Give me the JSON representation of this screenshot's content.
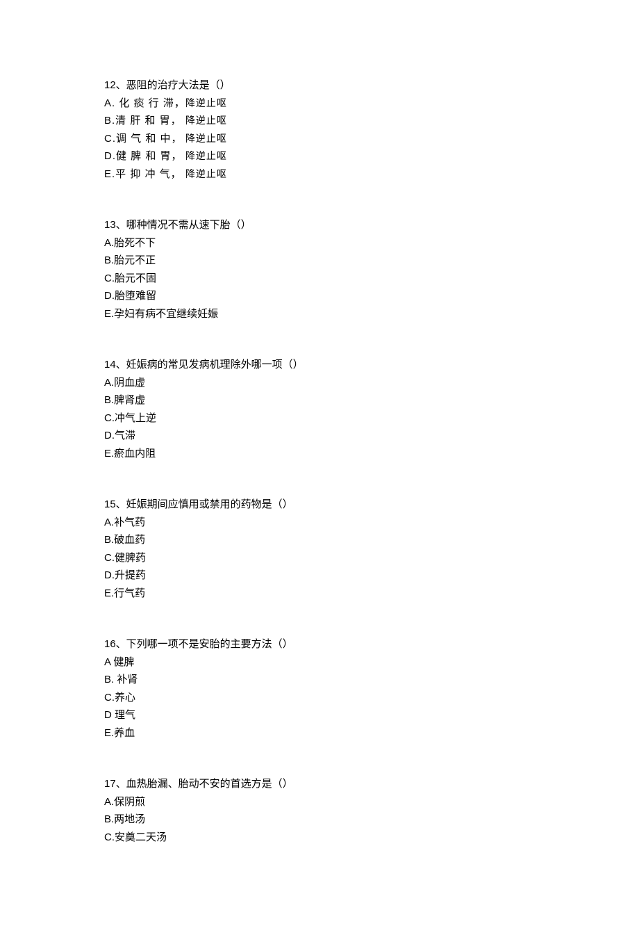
{
  "q12": {
    "stem": "12、恶阻的治疗大法是（）",
    "rows": [
      {
        "left": "A. 化 痰 行 滞，",
        "right": "降逆止呕"
      },
      {
        "left": "B.清 肝 和 胃，",
        "right": "降逆止呕"
      },
      {
        "left": "C.调 气 和 中，",
        "right": "降逆止呕"
      },
      {
        "left": "D.健 脾 和 胃，",
        "right": "降逆止呕"
      },
      {
        "left": "E.平 抑 冲 气，",
        "right": "降逆止呕"
      }
    ]
  },
  "q13": {
    "stem": "13、哪种情况不需从速下胎（）",
    "opts": [
      "A.胎死不下",
      "B.胎元不正",
      "C.胎元不固",
      "D.胎堕难留",
      "E.孕妇有病不宜继续妊娠"
    ]
  },
  "q14": {
    "stem": "14、妊娠病的常见发病机理除外哪一项（）",
    "opts": [
      "A.阴血虚",
      "B.脾肾虚",
      "C.冲气上逆",
      "D.气滞",
      "E.瘀血内阻"
    ]
  },
  "q15": {
    "stem": "15、妊娠期间应慎用或禁用的药物是（）",
    "opts": [
      "A.补气药",
      "B.破血药",
      "C.健脾药",
      "D.升提药",
      "E.行气药"
    ]
  },
  "q16": {
    "stem": "16、下列哪一项不是安胎的主要方法（）",
    "opts": [
      "A 健脾",
      "B. 补肾",
      "C.养心",
      "D 理气",
      "E.养血"
    ]
  },
  "q17": {
    "stem": "17、血热胎漏、胎动不安的首选方是（）",
    "opts": [
      "A.保阴煎",
      "B.两地汤",
      "C.安奠二天汤"
    ]
  }
}
